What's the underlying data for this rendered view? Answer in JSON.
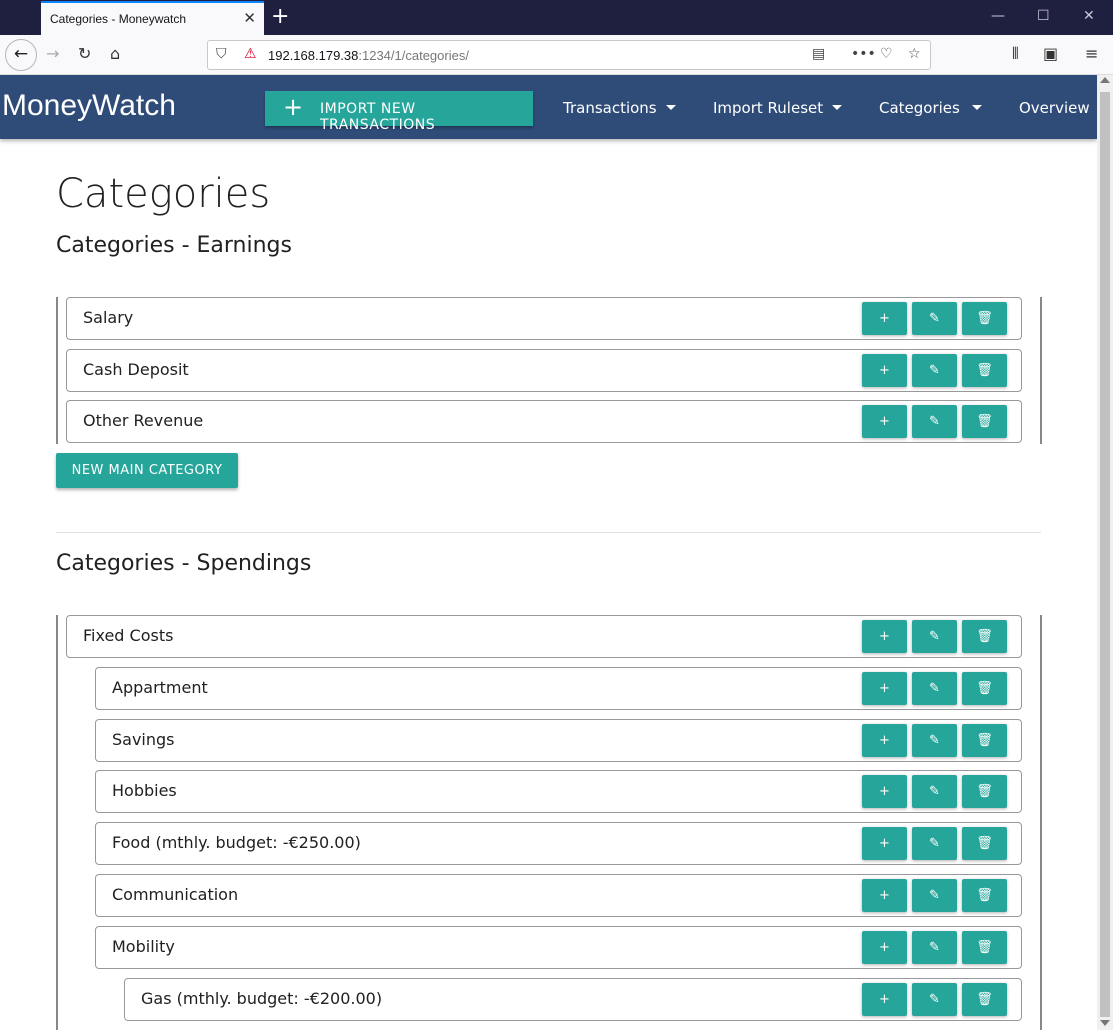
{
  "browser": {
    "tab_title": "Categories - Moneywatch",
    "url_host": "192.168.179.38",
    "url_path": ":1234/1/categories/"
  },
  "app": {
    "brand": "MoneyWatch",
    "import_button": "IMPORT NEW TRANSACTIONS",
    "nav": [
      "Transactions",
      "Import Ruleset",
      "Categories",
      "Overview"
    ]
  },
  "page": {
    "title": "Categories",
    "earnings_heading": "Categories - Earnings",
    "spendings_heading": "Categories - Spendings",
    "new_main_category": "NEW MAIN CATEGORY"
  },
  "earnings": [
    "Salary",
    "Cash Deposit",
    "Other Revenue"
  ],
  "spendings": [
    {
      "label": "Fixed Costs",
      "level": 0
    },
    {
      "label": "Appartment",
      "level": 1
    },
    {
      "label": "Savings",
      "level": 1
    },
    {
      "label": "Hobbies",
      "level": 1
    },
    {
      "label": "Food (mthly. budget: -€250.00)",
      "level": 1
    },
    {
      "label": "Communication",
      "level": 1
    },
    {
      "label": "Mobility",
      "level": 1
    },
    {
      "label": "Gas (mthly. budget: -€200.00)",
      "level": 2
    }
  ],
  "actions": {
    "add": "+",
    "edit": "✎",
    "delete": "🗑"
  },
  "colors": {
    "accent": "#26a69a",
    "appbar": "#2f4c78"
  }
}
